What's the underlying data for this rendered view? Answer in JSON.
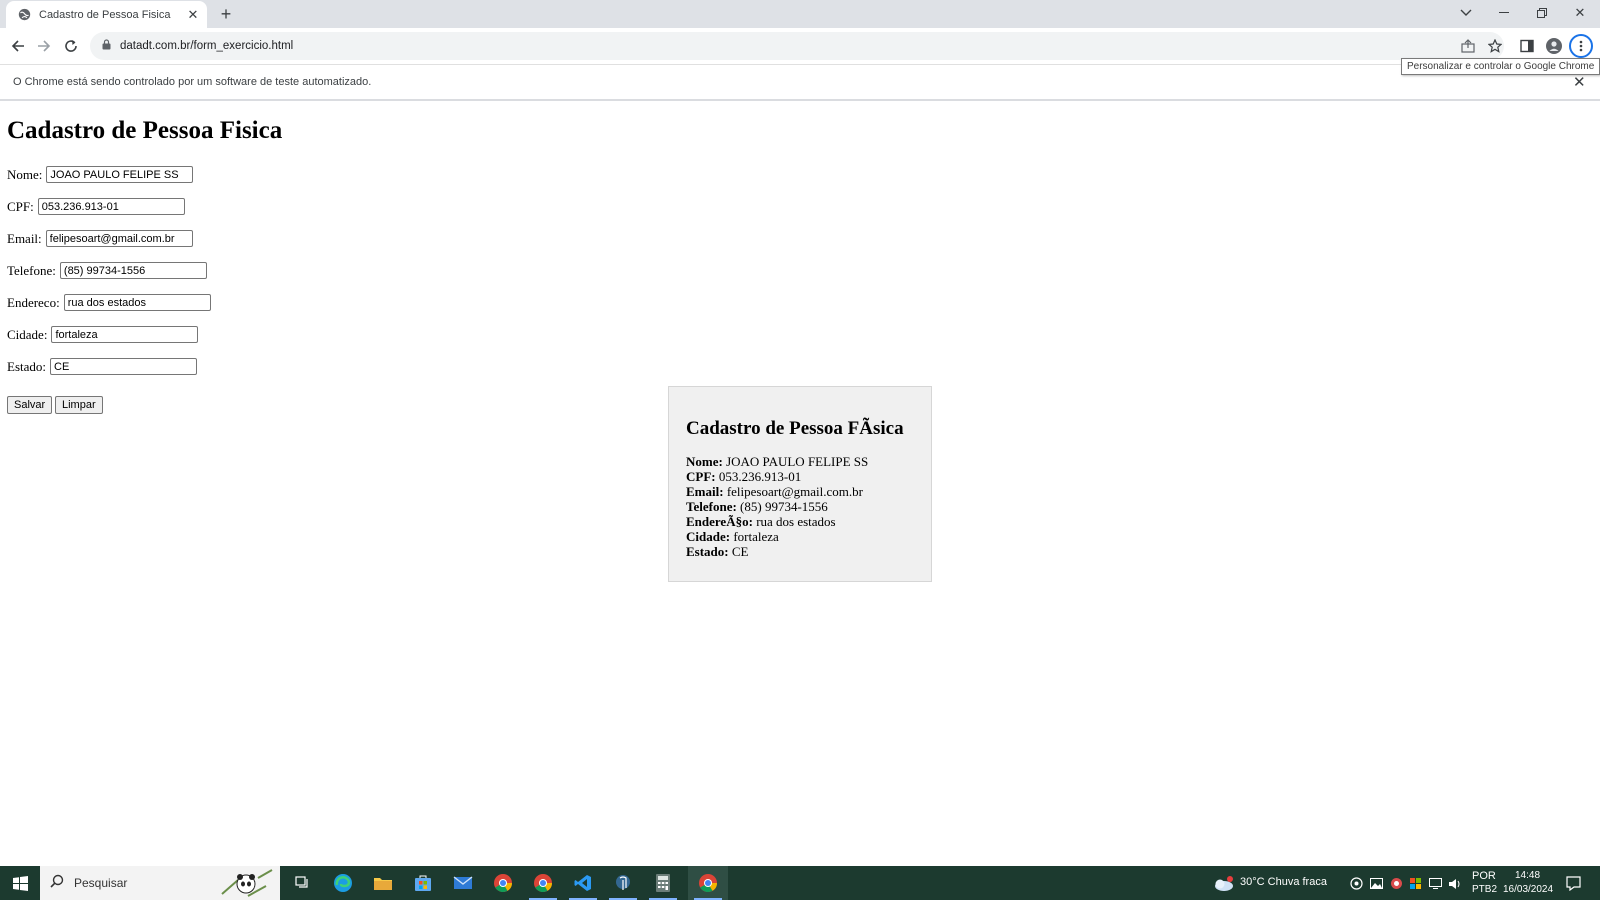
{
  "browser": {
    "tab_title": "Cadastro de Pessoa Fisica",
    "url": "datadt.com.br/form_exercicio.html",
    "automation_message": "O Chrome está sendo controlado por um software de teste automatizado.",
    "menu_tooltip": "Personalizar e controlar o Google Chrome"
  },
  "page": {
    "heading": "Cadastro de Pessoa Fisica",
    "fields": {
      "nome": {
        "label": "Nome:",
        "value": "JOAO PAULO FELIPE SS"
      },
      "cpf": {
        "label": "CPF:",
        "value": "053.236.913-01"
      },
      "email": {
        "label": "Email:",
        "value": "felipesoart@gmail.com.br"
      },
      "telefone": {
        "label": "Telefone:",
        "value": "(85) 99734-1556"
      },
      "endereco": {
        "label": "Endereco:",
        "value": "rua dos estados"
      },
      "cidade": {
        "label": "Cidade:",
        "value": "fortaleza"
      },
      "estado": {
        "label": "Estado:",
        "value": "CE"
      }
    },
    "buttons": {
      "save": "Salvar",
      "clear": "Limpar"
    }
  },
  "result": {
    "heading": "Cadastro de Pessoa FÃsica",
    "rows": [
      {
        "label": "Nome:",
        "value": "JOAO PAULO FELIPE SS"
      },
      {
        "label": "CPF:",
        "value": "053.236.913-01"
      },
      {
        "label": "Email:",
        "value": "felipesoart@gmail.com.br"
      },
      {
        "label": "Telefone:",
        "value": "(85) 99734-1556"
      },
      {
        "label": "EndereÃ§o:",
        "value": "rua dos estados"
      },
      {
        "label": "Cidade:",
        "value": "fortaleza"
      },
      {
        "label": "Estado:",
        "value": "CE"
      }
    ]
  },
  "taskbar": {
    "search_placeholder": "Pesquisar",
    "weather": "30°C  Chuva fraca",
    "lang_top": "POR",
    "lang_bottom": "PTB2",
    "time": "14:48",
    "date": "16/03/2024"
  },
  "colors": {
    "taskbar": "#1c3a2f",
    "tabstrip": "#dee1e6",
    "accent": "#1a73e8",
    "card_background": "#f0f0f0"
  }
}
